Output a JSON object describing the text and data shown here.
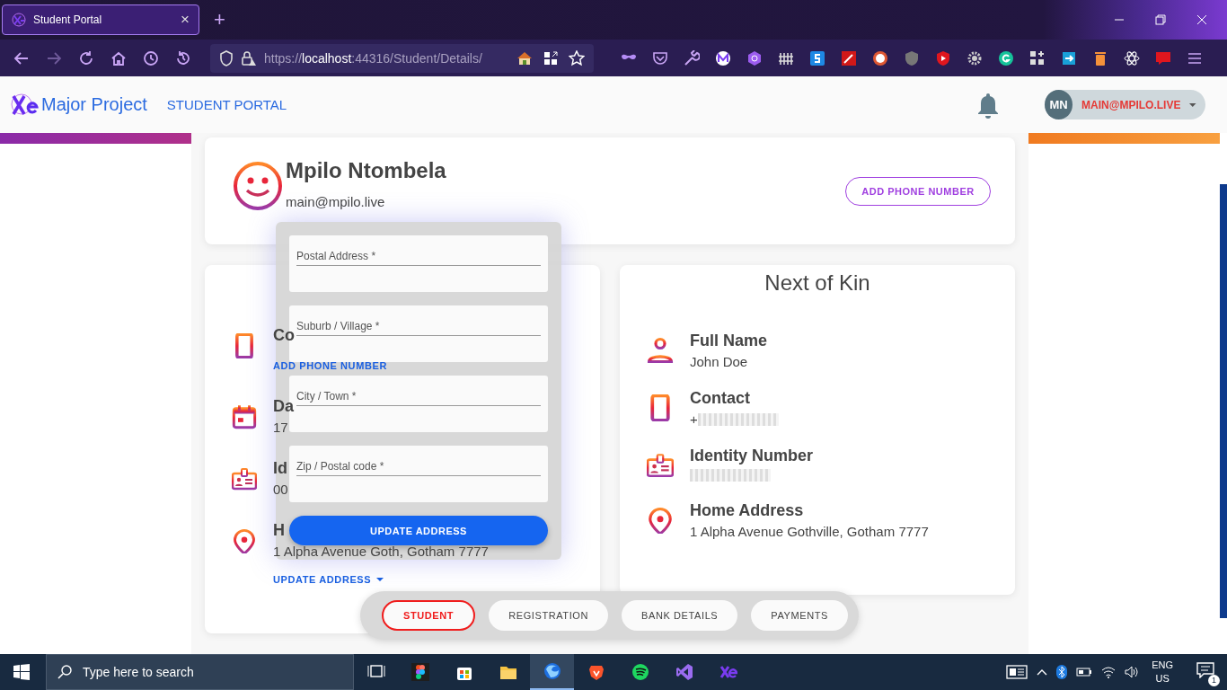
{
  "browser": {
    "tab_title": "Student Portal",
    "tab_close": "×",
    "new_tab": "+",
    "url_scheme": "https://",
    "url_host": "localhost",
    "url_path": ":44316/Student/Details/"
  },
  "header": {
    "brand": "Major Project",
    "nav_link": "STUDENT PORTAL",
    "user_initials": "MN",
    "user_email": "MAIN@MPILO.LIVE"
  },
  "profile": {
    "name": "Mpilo Ntombela",
    "email": "main@mpilo.live",
    "button": "ADD PHONE NUMBER"
  },
  "student_details": {
    "items": [
      {
        "kind": "phone",
        "label": "Co",
        "link": "ADD PHONE NUMBER"
      },
      {
        "kind": "calendar",
        "label": "Da",
        "value": "17"
      },
      {
        "kind": "id",
        "label": "Id",
        "value": "00"
      },
      {
        "kind": "location",
        "label": "H",
        "value": "1 Alpha Avenue Goth, Gotham 7777",
        "link": "UPDATE ADDRESS"
      }
    ]
  },
  "address_form": {
    "fields": [
      {
        "label": "Postal Address *"
      },
      {
        "label": "Suburb / Village *"
      },
      {
        "label": "City / Town *"
      },
      {
        "label": "Zip / Postal code *"
      }
    ],
    "button": "UPDATE ADDRESS"
  },
  "next_of_kin": {
    "title": "Next of Kin",
    "items": [
      {
        "kind": "person",
        "label": "Full Name",
        "value": "John Doe",
        "redacted": false
      },
      {
        "kind": "phone",
        "label": "Contact",
        "value": "+",
        "redacted": true
      },
      {
        "kind": "id",
        "label": "Identity Number",
        "redacted": true
      },
      {
        "kind": "location",
        "label": "Home Address",
        "value": "1 Alpha Avenue Gothville, Gotham 7777",
        "redacted": false
      }
    ]
  },
  "bottom_nav": [
    {
      "label": "STUDENT",
      "selected": true
    },
    {
      "label": "REGISTRATION",
      "selected": false
    },
    {
      "label": "BANK DETAILS",
      "selected": false
    },
    {
      "label": "PAYMENTS",
      "selected": false
    }
  ],
  "taskbar": {
    "search_placeholder": "Type here to search",
    "language": "ENG",
    "region": "US",
    "notification_count": "1"
  }
}
